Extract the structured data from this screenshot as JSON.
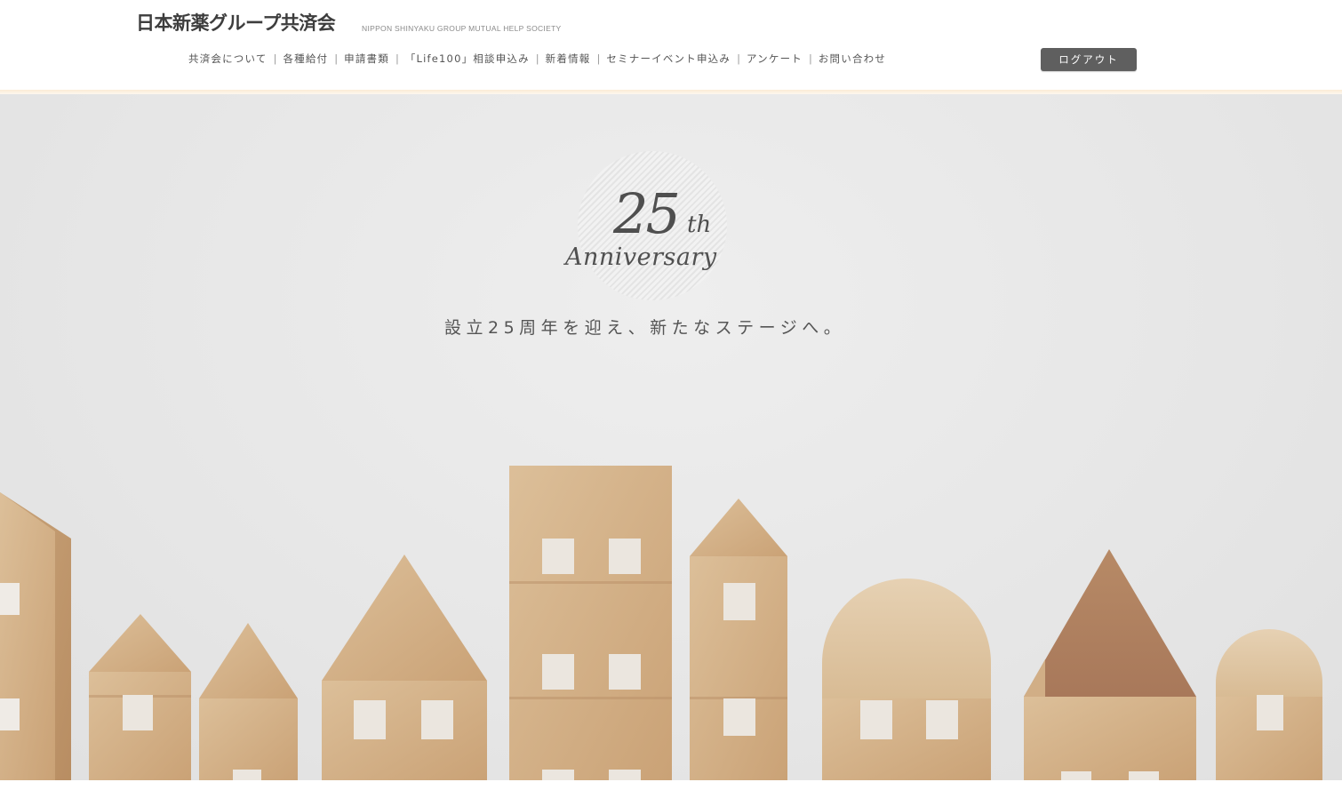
{
  "header": {
    "logo_ja": "日本新薬グループ共済会",
    "logo_en": "NIPPON SHINYAKU GROUP MUTUAL HELP SOCIETY",
    "nav": [
      {
        "label": "共済会について"
      },
      {
        "label": "各種給付"
      },
      {
        "label": "申請書類"
      },
      {
        "label": "「Life100」相談申込み"
      },
      {
        "label": "新着情報"
      },
      {
        "label": "セミナーイベント申込み"
      },
      {
        "label": "アンケート"
      },
      {
        "label": "お問い合わせ"
      }
    ],
    "nav_separator": "|",
    "logout_label": "ログアウト"
  },
  "hero": {
    "emblem_number": "25",
    "emblem_suffix": "th",
    "emblem_word": "Anniversary",
    "tagline": "設立25周年を迎え、新たなステージへ。"
  }
}
